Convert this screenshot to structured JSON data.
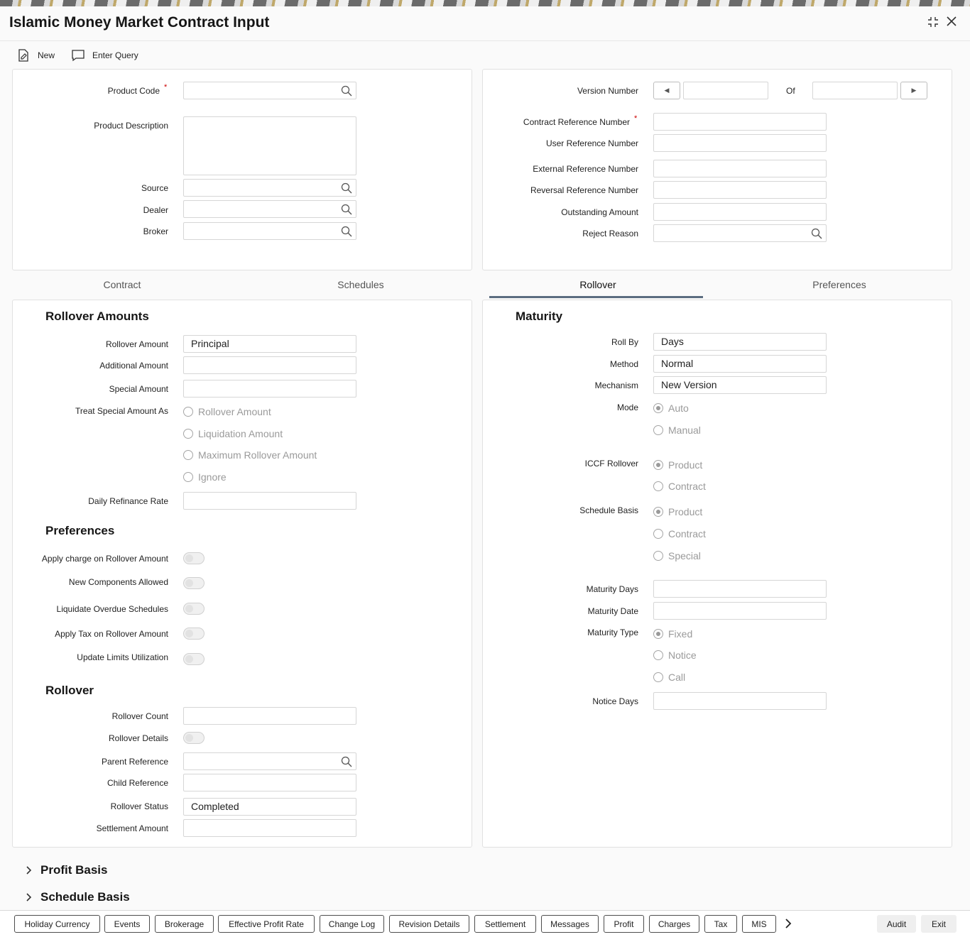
{
  "window": {
    "title": "Islamic Money Market Contract Input"
  },
  "toolbar": {
    "new_label": "New",
    "enter_query_label": "Enter Query"
  },
  "header_left": {
    "product_code_label": "Product Code",
    "product_description_label": "Product Description",
    "source_label": "Source",
    "dealer_label": "Dealer",
    "broker_label": "Broker",
    "required_mark": "*"
  },
  "header_right": {
    "version_number_label": "Version Number",
    "of_label": "Of",
    "contract_ref_label": "Contract Reference Number",
    "user_ref_label": "User Reference Number",
    "external_ref_label": "External Reference Number",
    "reversal_ref_label": "Reversal Reference Number",
    "outstanding_amount_label": "Outstanding Amount",
    "reject_reason_label": "Reject Reason",
    "required_mark": "*"
  },
  "tabs": [
    {
      "label": "Contract",
      "active": false
    },
    {
      "label": "Schedules",
      "active": false
    },
    {
      "label": "Rollover",
      "active": true
    },
    {
      "label": "Preferences",
      "active": false
    }
  ],
  "rollover_amounts": {
    "heading": "Rollover Amounts",
    "rollover_amount_label": "Rollover Amount",
    "rollover_amount_value": "Principal",
    "additional_amount_label": "Additional Amount",
    "special_amount_label": "Special Amount",
    "treat_special_label": "Treat Special Amount As",
    "treat_special_options": [
      "Rollover Amount",
      "Liquidation Amount",
      "Maximum Rollover Amount",
      "Ignore"
    ],
    "daily_refinance_label": "Daily Refinance Rate"
  },
  "preferences": {
    "heading": "Preferences",
    "apply_charge_label": "Apply charge on Rollover Amount",
    "new_components_label": "New Components Allowed",
    "liquidate_overdue_label": "Liquidate Overdue Schedules",
    "apply_tax_label": "Apply Tax on Rollover Amount",
    "update_limits_label": "Update Limits Utilization"
  },
  "rollover": {
    "heading": "Rollover",
    "count_label": "Rollover Count",
    "details_label": "Rollover Details",
    "parent_ref_label": "Parent Reference",
    "child_ref_label": "Child Reference",
    "status_label": "Rollover Status",
    "status_value": "Completed",
    "settlement_amount_label": "Settlement Amount"
  },
  "maturity": {
    "heading": "Maturity",
    "roll_by_label": "Roll By",
    "roll_by_value": "Days",
    "method_label": "Method",
    "method_value": "Normal",
    "mechanism_label": "Mechanism",
    "mechanism_value": "New Version",
    "mode_label": "Mode",
    "mode_options": [
      "Auto",
      "Manual"
    ],
    "iccf_label": "ICCF Rollover",
    "iccf_options": [
      "Product",
      "Contract"
    ],
    "schedule_basis_label": "Schedule Basis",
    "schedule_basis_options": [
      "Product",
      "Contract",
      "Special"
    ],
    "maturity_days_label": "Maturity Days",
    "maturity_date_label": "Maturity Date",
    "maturity_type_label": "Maturity Type",
    "maturity_type_options": [
      "Fixed",
      "Notice",
      "Call"
    ],
    "notice_days_label": "Notice Days"
  },
  "collapsibles": {
    "profit_basis": "Profit Basis",
    "schedule_basis": "Schedule Basis"
  },
  "footer": {
    "buttons": [
      "Holiday Currency",
      "Events",
      "Brokerage",
      "Effective Profit Rate",
      "Change Log",
      "Revision Details",
      "Settlement",
      "Messages",
      "Profit",
      "Charges",
      "Tax",
      "MIS"
    ],
    "audit_label": "Audit",
    "exit_label": "Exit"
  }
}
